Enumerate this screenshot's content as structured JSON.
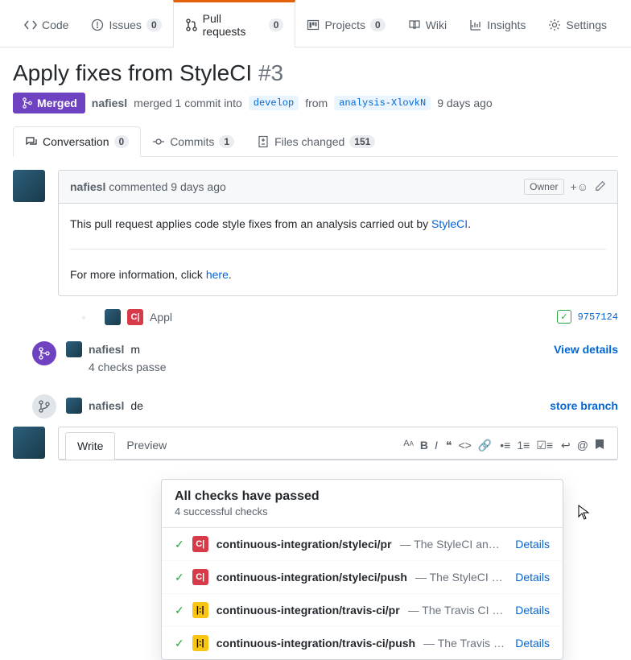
{
  "nav": {
    "code": "Code",
    "issues": "Issues",
    "issues_count": "0",
    "pull_requests": "Pull requests",
    "pull_requests_count": "0",
    "projects": "Projects",
    "projects_count": "0",
    "wiki": "Wiki",
    "insights": "Insights",
    "settings": "Settings"
  },
  "pr": {
    "title": "Apply fixes from StyleCI",
    "number": "#3",
    "state": "Merged",
    "author": "nafiesl",
    "merge_text": "merged 1 commit into",
    "base_branch": "develop",
    "from_text": "from",
    "head_branch": "analysis-XlovkN",
    "time": "9 days ago"
  },
  "convo_tabs": {
    "conversation": "Conversation",
    "conversation_count": "0",
    "commits": "Commits",
    "commits_count": "1",
    "files": "Files changed",
    "files_count": "151"
  },
  "comment": {
    "author": "nafiesl",
    "commented": "commented",
    "time": "9 days ago",
    "owner": "Owner",
    "body_a": "This pull request applies code style fixes from an analysis carried out by ",
    "body_link": "StyleCI",
    "body_b": ".",
    "info_a": "For more information, click ",
    "info_link": "here",
    "info_b": "."
  },
  "timeline": {
    "commit_msg": "Appl",
    "commit_hash": "9757124",
    "merged_by": "nafiesl",
    "merged_text": "m",
    "checks_passed": "4 checks passe",
    "view_details": "View details",
    "deleted_by": "nafiesl",
    "deleted_text": "de",
    "restore": "store branch"
  },
  "checks": {
    "title": "All checks have passed",
    "subtitle": "4 successful checks",
    "rows": [
      {
        "name": "continuous-integration/styleci/pr",
        "desc": "— The StyleCI an…",
        "details": "Details",
        "icon": "C|",
        "icon_color": "red"
      },
      {
        "name": "continuous-integration/styleci/push",
        "desc": "— The StyleCI …",
        "details": "Details",
        "icon": "C|",
        "icon_color": "red"
      },
      {
        "name": "continuous-integration/travis-ci/pr",
        "desc": "— The Travis CI …",
        "details": "Details",
        "icon": "|:|",
        "icon_color": "yellow"
      },
      {
        "name": "continuous-integration/travis-ci/push",
        "desc": "— The Travis …",
        "details": "Details",
        "icon": "|:|",
        "icon_color": "yellow"
      }
    ]
  },
  "compose": {
    "write": "Write",
    "preview": "Preview"
  }
}
